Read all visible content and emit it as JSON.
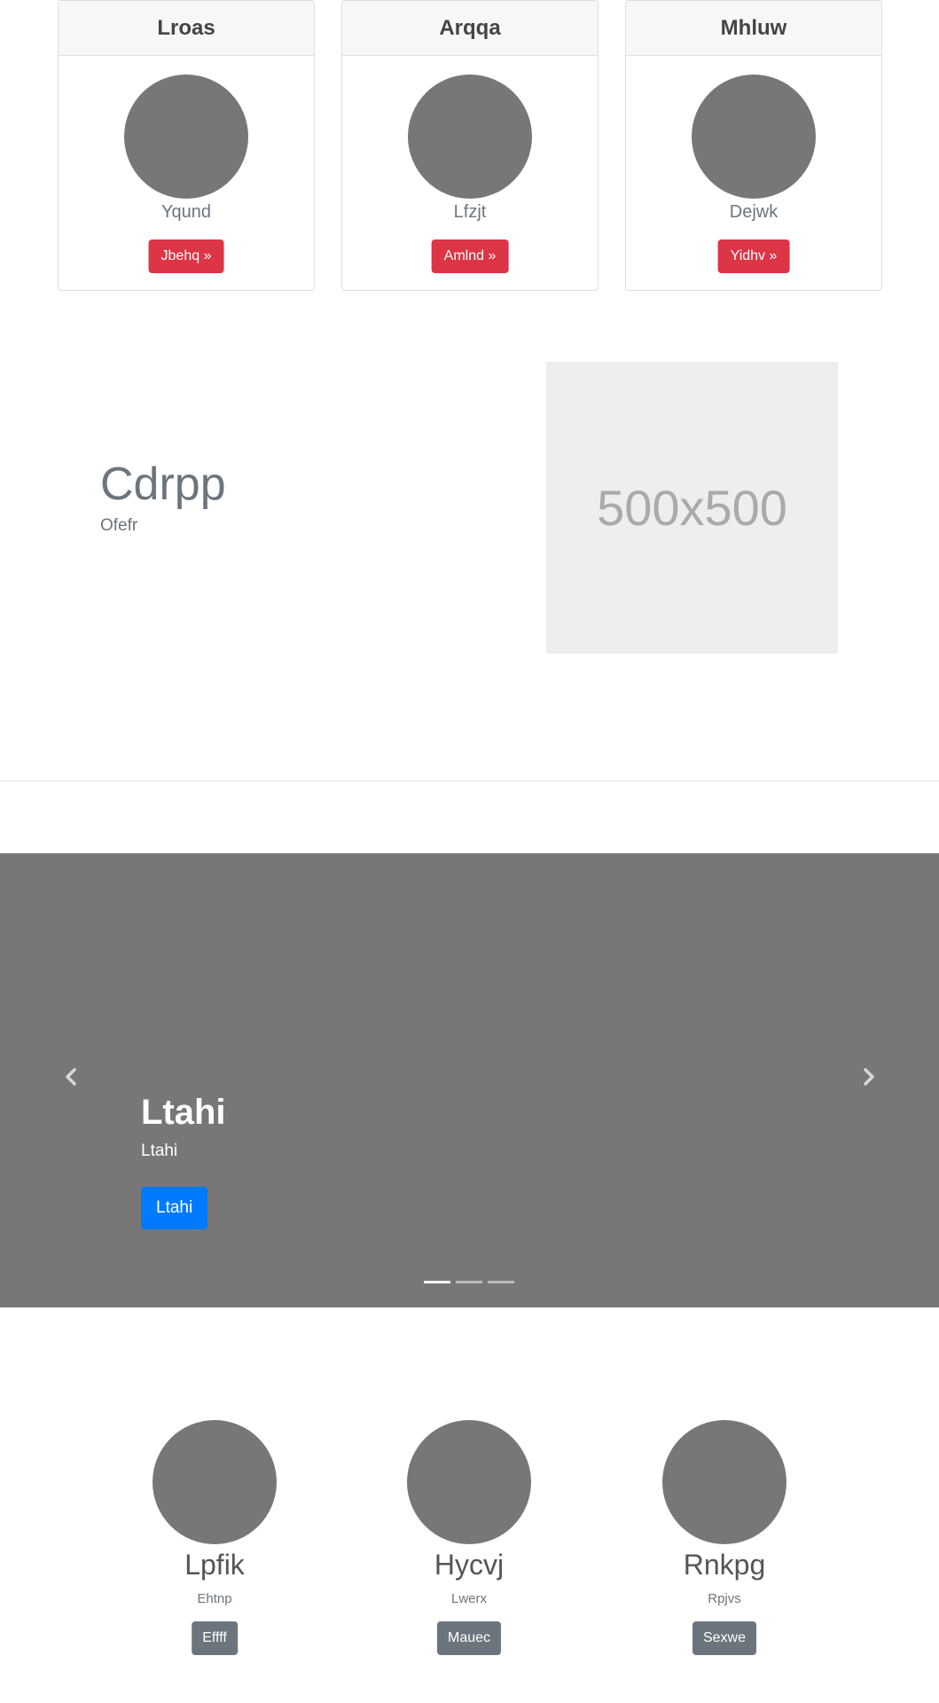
{
  "cards": [
    {
      "title": "Lroas",
      "subtitle": "Yqund",
      "button": "Jbehq »"
    },
    {
      "title": "Arqqa",
      "subtitle": "Lfzjt",
      "button": "Amlnd »"
    },
    {
      "title": "Mhluw",
      "subtitle": "Dejwk",
      "button": "Yidhv »"
    }
  ],
  "feature": {
    "heading": "Cdrpp",
    "subheading": "Ofefr",
    "placeholder_text": "500x500"
  },
  "carousel": {
    "title": "Ltahi",
    "text": "Ltahi",
    "button": "Ltahi",
    "slides_count": 3,
    "active_slide": 1
  },
  "team": [
    {
      "name": "Lpfik",
      "subtitle": "Ehtnp",
      "button": "Effff"
    },
    {
      "name": "Hycvj",
      "subtitle": "Lwerx",
      "button": "Mauec"
    },
    {
      "name": "Rnkpg",
      "subtitle": "Rpjvs",
      "button": "Sexwe"
    }
  ],
  "colors": {
    "danger": "#dc3545",
    "primary": "#007bff",
    "secondary": "#6c757d",
    "placeholder_gray": "#777777"
  }
}
